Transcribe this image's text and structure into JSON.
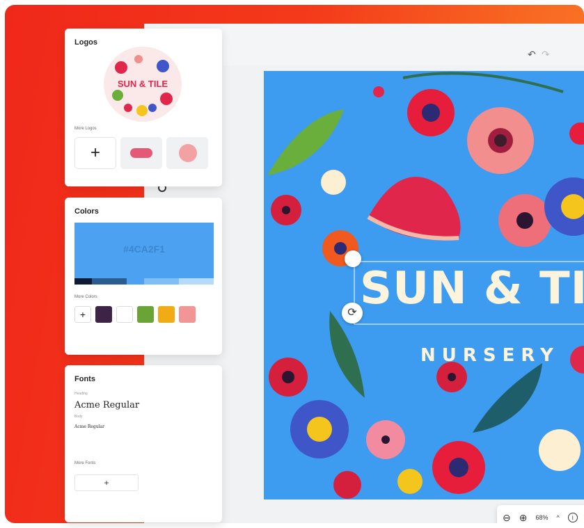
{
  "logos_panel": {
    "title": "Logos",
    "logo_text": "SUN & TILE",
    "more_label": "More Logos",
    "add_symbol": "+"
  },
  "colors_panel": {
    "title": "Colors",
    "hex": "#4CA2F1",
    "main_color": "#4ca2f1",
    "palette_strip": [
      "#0e1b33",
      "#2a5c8f",
      "#4ca2f1",
      "#7fbef6",
      "#b5dafa"
    ],
    "more_label": "More Colors",
    "add_symbol": "+",
    "swatches": [
      "#3d2346",
      "#ffffff",
      "#6aa336",
      "#f1ab14",
      "#f29595"
    ]
  },
  "fonts_panel": {
    "title": "Fonts",
    "heading_label": "Heading",
    "heading_font": "Acme Regular",
    "body_label": "Body",
    "body_font": "Acme Regular",
    "more_label": "More Fonts",
    "add_symbol": "+"
  },
  "toolbar": {
    "undo_icon": "↶",
    "redo_icon": "↷"
  },
  "canvas": {
    "title": "SUN & TIL",
    "subtitle": "NURSERY",
    "background": "#3d9cf0"
  },
  "zoom": {
    "level": "68%",
    "caret": "^",
    "info": "i"
  }
}
